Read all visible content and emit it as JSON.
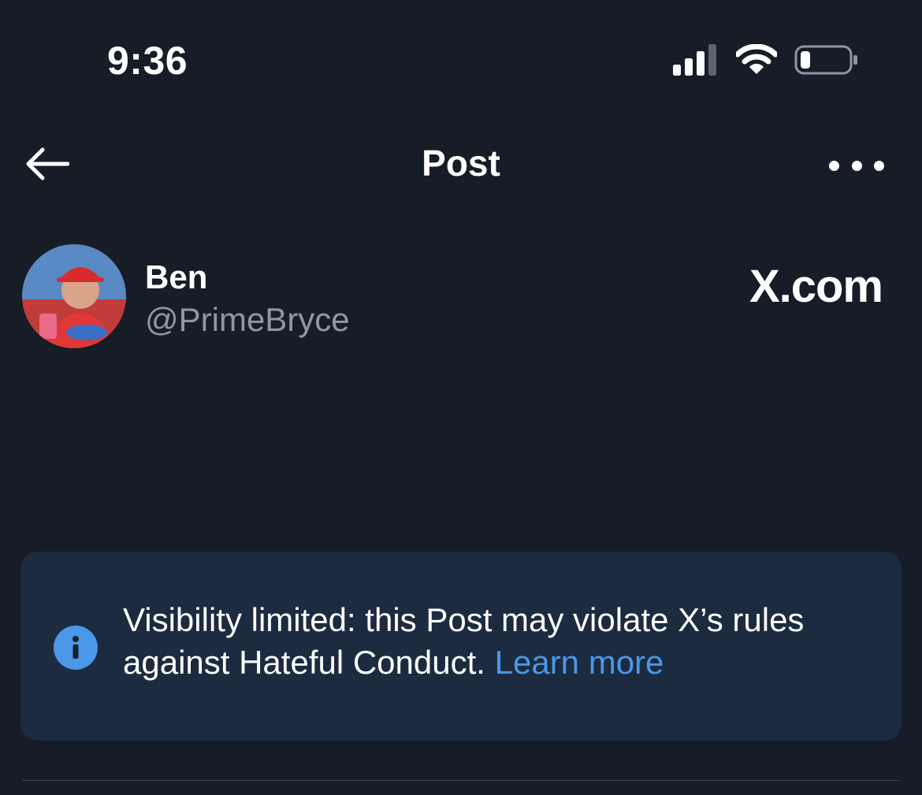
{
  "status_bar": {
    "time": "9:36",
    "icons": [
      "cellular-signal-icon",
      "wifi-icon",
      "battery-icon"
    ]
  },
  "nav": {
    "title": "Post",
    "back_icon": "back-arrow-icon",
    "more_icon": "more-options-icon"
  },
  "author": {
    "name": "Ben",
    "handle": "@PrimeBryce",
    "avatar_icon": "avatar-photo",
    "source": "X.com"
  },
  "notice": {
    "icon": "info-icon",
    "text": "Visibility limited: this Post may violate X’s rules against Hateful Conduct.",
    "link": "Learn more"
  },
  "colors": {
    "background": "#161d27",
    "notice_background": "#1c2b3f",
    "accent": "#4b97e8",
    "secondary_text": "#8b98a5"
  }
}
